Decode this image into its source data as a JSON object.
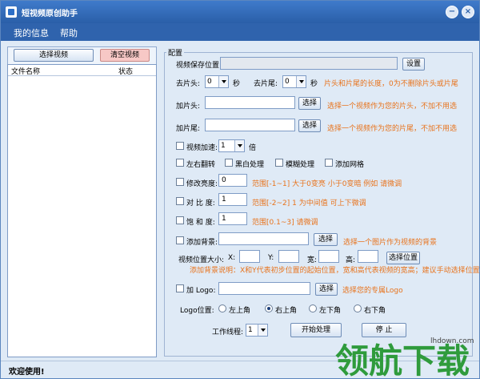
{
  "window": {
    "title": "短视频原创助手",
    "minimize": "−",
    "close": "×"
  },
  "menu": [
    "我的信息",
    "帮助"
  ],
  "left": {
    "select_video": "选择视频",
    "clear_video": "清空视频",
    "columns": [
      "文件名称",
      "状态"
    ]
  },
  "config": {
    "group_title": "配置",
    "save_path_label": "视频保存位置:",
    "save_path_value": "",
    "settings_button": "设置",
    "trim_head_label": "去片头:",
    "trim_head_value": "0",
    "trim_tail_label": "去片尾:",
    "trim_tail_value": "0",
    "seconds_unit": "秒",
    "trim_hint": "片头和片尾的长度，0为不删除片头或片尾",
    "add_head_label": "加片头:",
    "add_tail_label": "加片尾:",
    "select_button": "选择",
    "add_head_hint": "选择一个视频作为您的片头，不加不用选",
    "add_tail_hint": "选择一个视频作为您的片尾，不加不用选",
    "speed_label": "视频加速:",
    "speed_value": "1",
    "speed_unit": "倍",
    "flip_label": "左右翻转",
    "bw_label": "黑白处理",
    "blur_label": "模糊处理",
    "grid_label": "添加网格",
    "brightness_label": "修改亮度:",
    "brightness_value": "0",
    "brightness_hint": "范围[-1~1]   大于0变亮 小于0变暗  例如 请微调",
    "contrast_label": "对 比 度:",
    "contrast_value": "1",
    "contrast_hint": "范围[-2~2]  1 为中间值  可上下微调",
    "saturation_label": "饱 和 度:",
    "saturation_value": "1",
    "saturation_hint": "范围[0.1~3]  请微调",
    "bg_label": "添加背景:",
    "bg_hint": "选择一个图片作为视频的背景",
    "pos_size_label": "视频位置大小:",
    "x_label": "X:",
    "y_label": "Y:",
    "w_label": "宽:",
    "h_label": "高:",
    "select_pos_button": "选择位置",
    "bg_note": "添加背景说明：X和Y代表初步位置的起始位置，宽和高代表视频的宽高；建议手动选择位置",
    "logo_label": "加 Logo:",
    "logo_hint": "选择您的专属Logo",
    "logo_pos_label": "Logo位置:",
    "logo_positions": [
      "左上角",
      "右上角",
      "左下角",
      "右下角"
    ],
    "logo_selected": 1,
    "threads_label": "工作线程:",
    "threads_value": "1",
    "start_button": "开始处理",
    "stop_button": "停  止"
  },
  "status": "欢迎使用!",
  "watermark": {
    "text": "领航下载",
    "url": "lhdown.com"
  },
  "colors": {
    "titlebar": "#2f63ad",
    "hint": "#e8731c",
    "watermark": "#2f9b3c"
  }
}
